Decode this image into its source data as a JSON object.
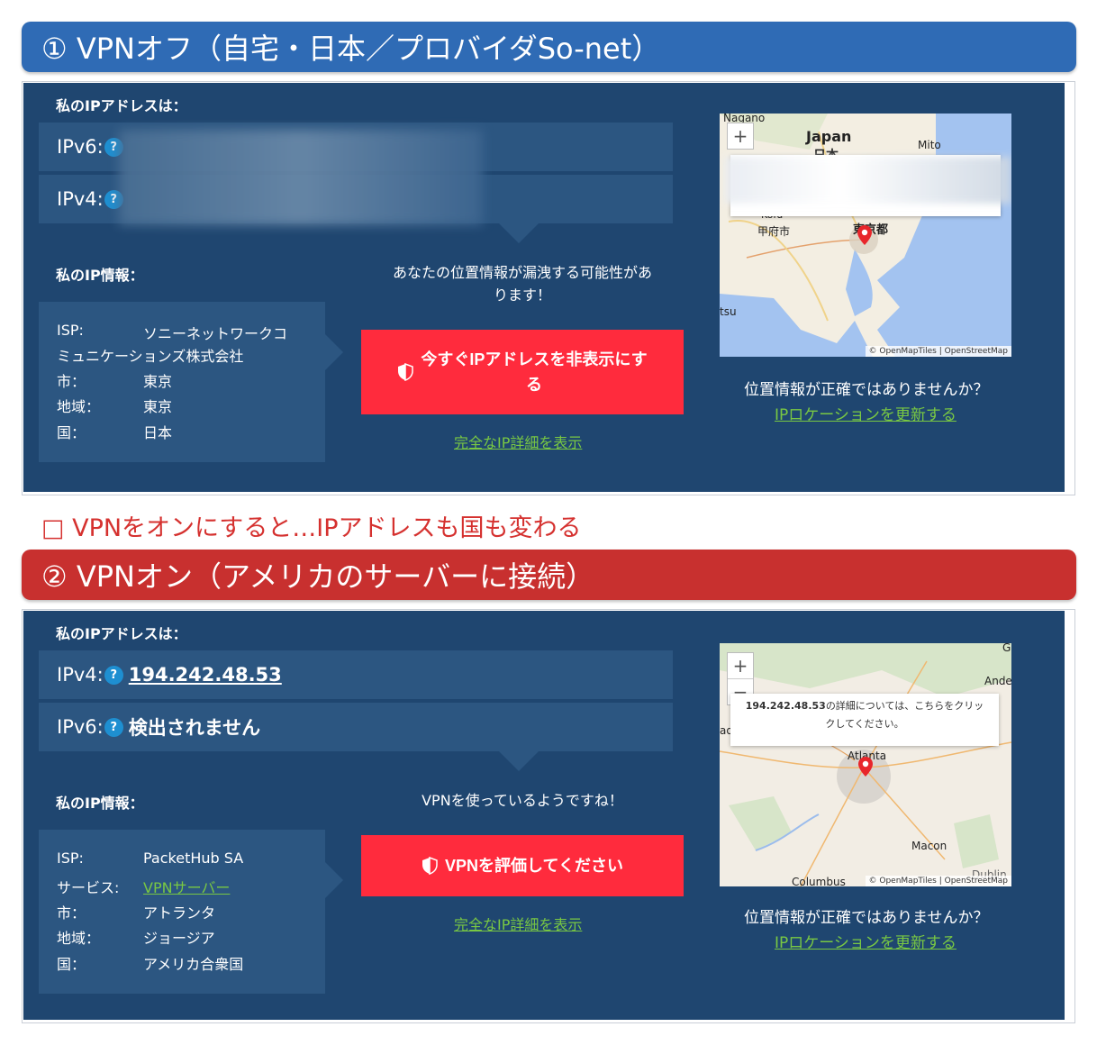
{
  "banner1": "① VPNオフ（自宅・日本／プロバイダSo-net）",
  "between": "□ VPNをオンにすると…IPアドレスも国も変わる",
  "banner2": "② VPNオン（アメリカのサーバーに接続）",
  "colors": {
    "blue_banner": "#2f6bb5",
    "red_banner": "#c8302f",
    "panel": "#1f4670",
    "row": "#2c5681",
    "button": "#ff2b3d",
    "link": "#79c843"
  },
  "panel1": {
    "my_ip_label": "私のIPアドレスは：",
    "rows": [
      {
        "label": "IPv6:",
        "help": "?",
        "value": ""
      },
      {
        "label": "IPv4:",
        "help": "?",
        "value": ""
      }
    ],
    "my_info_label": "私のIP情報：",
    "info": {
      "isp_key": "ISP:",
      "isp_val_1": "ソニーネットワークコ",
      "isp_val_2": "ミュニケーションズ株式会社",
      "city_key": "市：",
      "city_val": "東京",
      "region_key": "地域：",
      "region_val": "東京",
      "country_key": "国：",
      "country_val": "日本"
    },
    "warning_1": "あなたの位置情報が漏洩する可能性があ",
    "warning_2": "ります！",
    "button_1": "今すぐIPアドレスを非表示にす",
    "button_2": "る",
    "button_icon": "shield-icon",
    "detail_link": "完全なIP詳細を表示",
    "map": {
      "labels": [
        "Nagano",
        "Japan",
        "日本",
        "Mito",
        "Kofu",
        "甲府市",
        "東京都",
        "tsu"
      ],
      "zoom_in": "+",
      "credit": "© OpenMapTiles | OpenStreetMap"
    },
    "loc_question": "位置情報が正確ではありませんか？",
    "loc_link": "IPロケーションを更新する"
  },
  "panel2": {
    "my_ip_label": "私のIPアドレスは：",
    "rows": [
      {
        "label": "IPv4:",
        "help": "?",
        "value": "194.242.48.53"
      },
      {
        "label": "IPv6:",
        "help": "?",
        "value": "検出されません"
      }
    ],
    "my_info_label": "私のIP情報：",
    "info": {
      "isp_key": "ISP:",
      "isp_val": "PacketHub SA",
      "service_key": "サービス:",
      "service_val": "VPNサーバー",
      "city_key": "市：",
      "city_val": "アトランタ",
      "region_key": "地域：",
      "region_val": "ジョージア",
      "country_key": "国：",
      "country_val": "アメリカ合衆国"
    },
    "warning": "VPNを使っているようですね！",
    "button": "VPNを評価してください",
    "button_icon": "shield-icon",
    "detail_link": "完全なIP詳細を表示",
    "map": {
      "labels": [
        "G",
        "Ande",
        "ad",
        "Atlanta",
        "Macon",
        "Columbus",
        "Dublin"
      ],
      "zoom_in": "+",
      "zoom_out": "−",
      "popup_ip": "194.242.48.53",
      "popup_1": "の詳細については、こちらをクリッ",
      "popup_2": "クしてください。",
      "credit": "© OpenMapTiles | OpenStreetMap"
    },
    "loc_question": "位置情報が正確ではありませんか？",
    "loc_link": "IPロケーションを更新する"
  }
}
